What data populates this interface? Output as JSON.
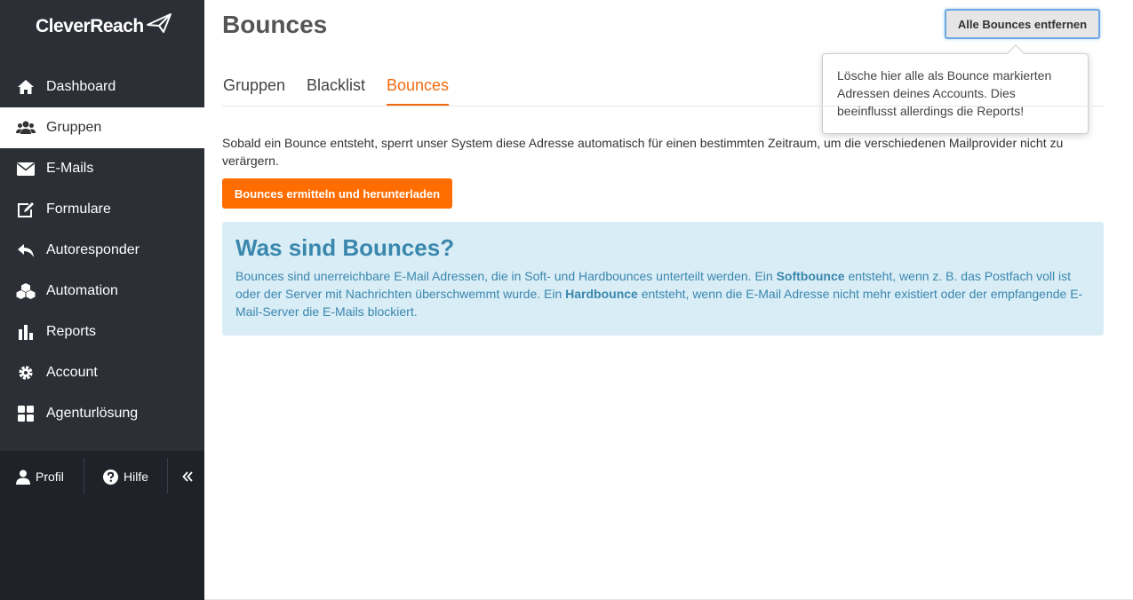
{
  "app": {
    "logo_text": "CleverReach"
  },
  "sidebar": {
    "items": [
      {
        "label": "Dashboard",
        "icon": "home-icon"
      },
      {
        "label": "Gruppen",
        "icon": "users-icon"
      },
      {
        "label": "E-Mails",
        "icon": "envelope-icon"
      },
      {
        "label": "Formulare",
        "icon": "edit-icon"
      },
      {
        "label": "Autoresponder",
        "icon": "reply-icon"
      },
      {
        "label": "Automation",
        "icon": "cubes-icon"
      },
      {
        "label": "Reports",
        "icon": "bar-chart-icon"
      },
      {
        "label": "Account",
        "icon": "gear-icon"
      },
      {
        "label": "Agenturlösung",
        "icon": "grid-icon"
      }
    ],
    "active_item": "Gruppen",
    "bottom": {
      "profil_label": "Profil",
      "hilfe_label": "Hilfe"
    }
  },
  "page": {
    "title": "Bounces",
    "remove_button": "Alle Bounces entfernen",
    "tooltip": "Lösche hier alle als Bounce markierten Adressen deines Accounts. Dies beeinflusst allerdings die Reports!",
    "tabs": [
      {
        "label": "Gruppen"
      },
      {
        "label": "Blacklist"
      },
      {
        "label": "Bounces"
      }
    ],
    "active_tab": "Bounces",
    "intro": "Sobald ein Bounce entsteht, sperrt unser System diese Adresse automatisch für einen bestimmten Zeitraum, um die verschiedenen Mailprovider nicht zu verärgern.",
    "download_button": "Bounces ermitteln und herunterladen",
    "info": {
      "title": "Was sind Bounces?",
      "text_1": "Bounces sind unerreichbare E-Mail Adressen, die in Soft- und Hardbounces unterteilt werden. Ein ",
      "softbounce": "Softbounce",
      "text_2": " entsteht, wenn z. B. das Postfach voll ist oder der Server mit Nachrichten überschwemmt wurde. Ein ",
      "hardbounce": "Hardbounce",
      "text_3": " entsteht, wenn die E-Mail Adresse nicht mehr existiert oder der empfangende E-Mail-Server die E-Mails blockiert."
    }
  },
  "colors": {
    "sidebar_bg": "#2c2f36",
    "sidebar_bottom_bg": "#1f2229",
    "accent_orange": "#ff6c00",
    "tab_active": "#f26a0f",
    "info_bg": "#d9edf7",
    "info_text": "#3a87ad"
  }
}
